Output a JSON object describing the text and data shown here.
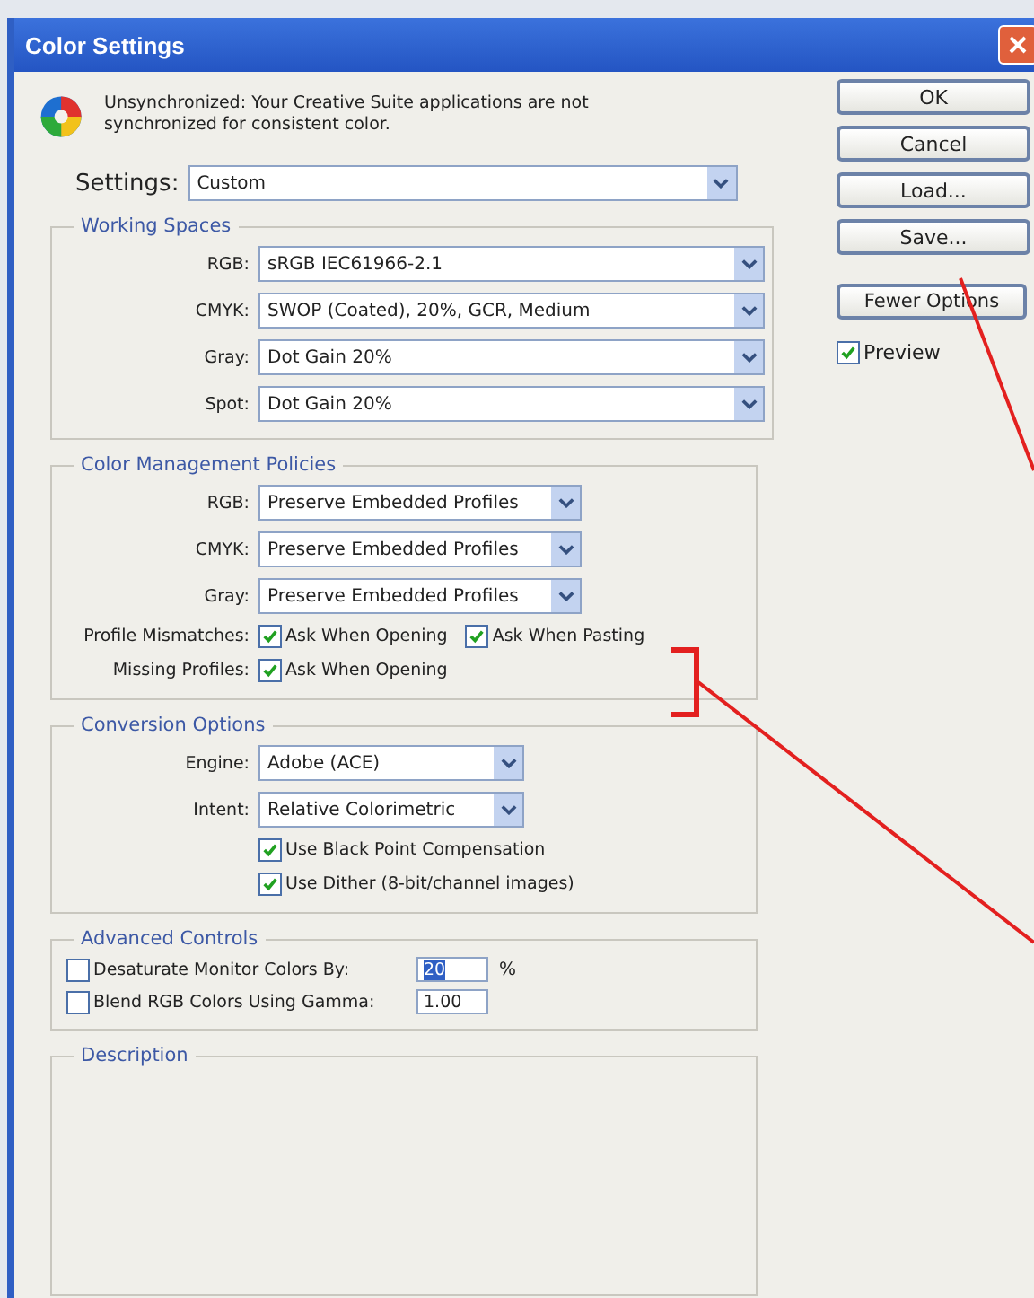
{
  "window": {
    "title": "Color Settings"
  },
  "notice": "Unsynchronized: Your Creative Suite applications are not synchronized for consistent color.",
  "settings": {
    "label": "Settings:",
    "value": "Custom"
  },
  "working_spaces": {
    "title": "Working Spaces",
    "rows": [
      {
        "label": "RGB:",
        "value": "sRGB IEC61966-2.1"
      },
      {
        "label": "CMYK:",
        "value": "SWOP (Coated), 20%, GCR, Medium"
      },
      {
        "label": "Gray:",
        "value": "Dot Gain 20%"
      },
      {
        "label": "Spot:",
        "value": "Dot Gain 20%"
      }
    ]
  },
  "policies": {
    "title": "Color Management Policies",
    "rows": [
      {
        "label": "RGB:",
        "value": "Preserve Embedded Profiles"
      },
      {
        "label": "CMYK:",
        "value": "Preserve Embedded Profiles"
      },
      {
        "label": "Gray:",
        "value": "Preserve Embedded Profiles"
      }
    ],
    "checks": [
      {
        "label": "Profile Mismatches:",
        "options": [
          {
            "label": "Ask When Opening",
            "checked": true
          },
          {
            "label": "Ask When Pasting",
            "checked": true
          }
        ]
      },
      {
        "label": "Missing Profiles:",
        "options": [
          {
            "label": "Ask When Opening",
            "checked": true
          }
        ]
      }
    ]
  },
  "conversion": {
    "title": "Conversion Options",
    "rows": [
      {
        "label": "Engine:",
        "value": "Adobe (ACE)"
      },
      {
        "label": "Intent:",
        "value": "Relative Colorimetric"
      }
    ],
    "options": [
      {
        "label": "Use Black Point Compensation",
        "checked": true
      },
      {
        "label": "Use Dither (8-bit/channel images)",
        "checked": true
      }
    ]
  },
  "advanced": {
    "title": "Advanced Controls",
    "rows": [
      {
        "label": "Desaturate Monitor Colors By:",
        "checked": false,
        "value": "20",
        "unit": "%"
      },
      {
        "label": "Blend RGB Colors Using Gamma:",
        "checked": false,
        "value": "1.00"
      }
    ]
  },
  "description": {
    "title": "Description"
  },
  "buttons": [
    "OK",
    "Cancel",
    "Load...",
    "Save...",
    "Fewer Options"
  ],
  "preview": {
    "label": "Preview",
    "checked": true
  }
}
